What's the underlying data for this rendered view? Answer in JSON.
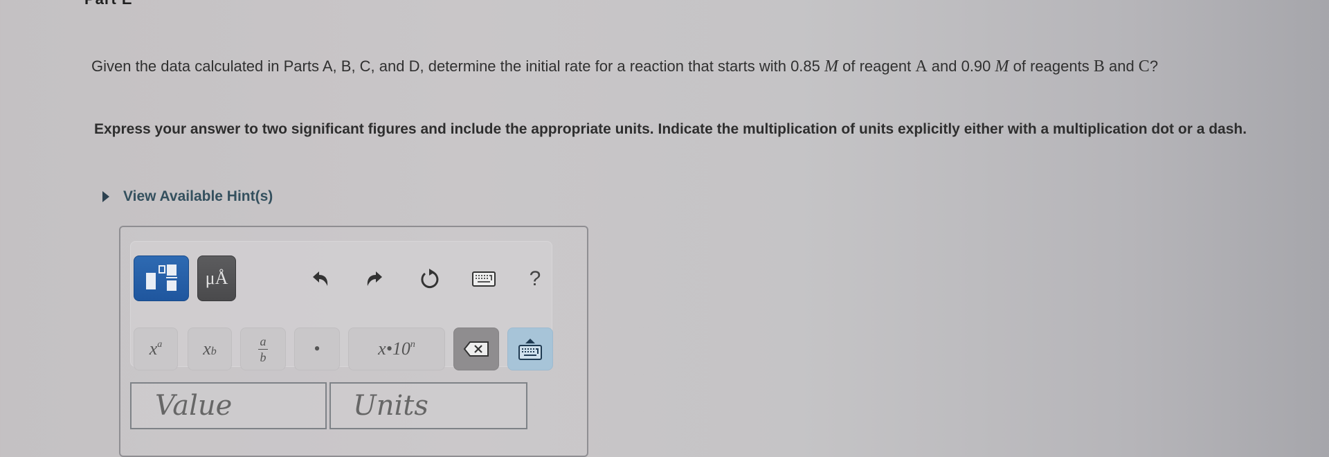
{
  "part": {
    "label": "Part E"
  },
  "question": {
    "text_1": "Given the data calculated in Parts A, B, C, and D, determine the initial rate for a reaction that starts with 0.85 ",
    "unit_1": "M",
    "text_2": " of reagent ",
    "reagent_a": "A",
    "text_3": " and 0.90 ",
    "unit_2": "M",
    "text_4": " of reagents ",
    "reagent_b": "B",
    "text_5": " and ",
    "reagent_c": "C",
    "text_6": "?"
  },
  "instruction": "Express your answer to two significant figures and include the appropriate units. Indicate the multiplication of units explicitly either with a multiplication dot or a dash.",
  "hint": {
    "label": "View Available Hint(s)",
    "icon": "triangle-right-icon"
  },
  "toolbar": {
    "templates_button": {
      "icon": "templates-icon",
      "active": true
    },
    "units_button": {
      "label": "μÅ",
      "icon": "units-icon"
    },
    "undo": {
      "icon": "undo-icon"
    },
    "redo": {
      "icon": "redo-icon"
    },
    "reset": {
      "icon": "reset-icon"
    },
    "keyboard": {
      "icon": "keyboard-icon"
    },
    "help": {
      "label": "?"
    }
  },
  "keys": {
    "superscript": {
      "base": "x",
      "exp": "a"
    },
    "subscript": {
      "base": "x",
      "sub": "b"
    },
    "fraction": {
      "num": "a",
      "den": "b"
    },
    "dot": {
      "label": "•"
    },
    "sci_notation": {
      "base": "x•10",
      "exp": "n"
    },
    "backspace": {
      "icon": "backspace-icon"
    },
    "keyboard_toggle": {
      "icon": "keyboard-toggle-icon"
    }
  },
  "inputs": {
    "value": {
      "placeholder": "Value",
      "value": ""
    },
    "units": {
      "placeholder": "Units",
      "value": ""
    }
  },
  "colors": {
    "template_active": "#2463ad",
    "units_button": "#545456",
    "keyboard_toggle": "#a7c4d8",
    "backspace": "#8f8d8f",
    "hint_text": "#34505e"
  }
}
